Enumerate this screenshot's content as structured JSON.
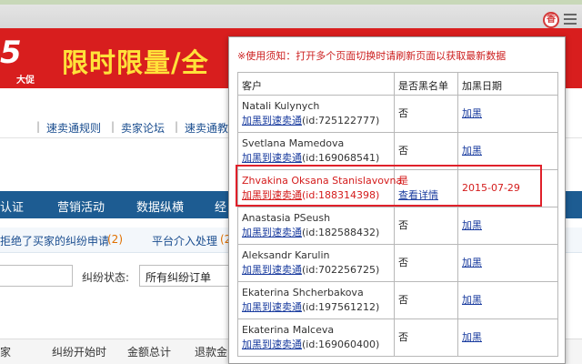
{
  "browser": {
    "extension_icon_label": "香",
    "colors": {
      "highlight": "#e0202a",
      "banner_red": "#d81e1e",
      "nav_blue": "#1d5c92"
    }
  },
  "page": {
    "banner_number": "5",
    "banner_tag": "大促",
    "banner_text": "限时限量/全",
    "top_links": [
      "速卖通规则",
      "卖家论坛",
      "速卖通教"
    ],
    "main_nav": [
      "认证",
      "营销活动",
      "数据纵横",
      "经"
    ],
    "notice_left": "拒绝了买家的纠纷申请",
    "notice_left_count": "(2)",
    "notice_right": "平台介入处理",
    "notice_right_count": "(2",
    "filter_label": "纠纷状态:",
    "filter_value": "所有纠纷订单",
    "table_headers": [
      "家",
      "纠纷开始时",
      "金额总计",
      "退款金"
    ]
  },
  "popup": {
    "notice": "※使用须知：打开多个页面切换时请刷新页面以获取最新数据",
    "headers": {
      "customer": "客户",
      "blacklisted": "是否黑名单",
      "date": "加黑日期"
    },
    "rows": [
      {
        "name": "Natali Kulynych",
        "link": "加黑到速卖通",
        "id": "(id:725122777)",
        "status": "否",
        "action": "加黑"
      },
      {
        "name": "Svetlana Mamedova",
        "link": "加黑到速卖通",
        "id": "(id:169068541)",
        "status": "否",
        "action": "加黑"
      },
      {
        "name": "Zhvakina Oksana Stanislavovna",
        "link": "加黑到速卖通",
        "id": "(id:188314398)",
        "status": "是",
        "detail": "查看详情",
        "date": "2015-07-29"
      },
      {
        "name": "Anastasia PSeush",
        "link": "加黑到速卖通",
        "id": "(id:182588432)",
        "status": "否",
        "action": "加黑"
      },
      {
        "name": "Aleksandr Karulin",
        "link": "加黑到速卖通",
        "id": "(id:702256725)",
        "status": "否",
        "action": "加黑"
      },
      {
        "name": "Ekaterina Shcherbakova",
        "link": "加黑到速卖通",
        "id": "(id:197561212)",
        "status": "否",
        "action": "加黑"
      },
      {
        "name": "Ekaterina Malceva",
        "link": "加黑到速卖通",
        "id": "(id:169060400)",
        "status": "否",
        "action": "加黑"
      }
    ]
  }
}
